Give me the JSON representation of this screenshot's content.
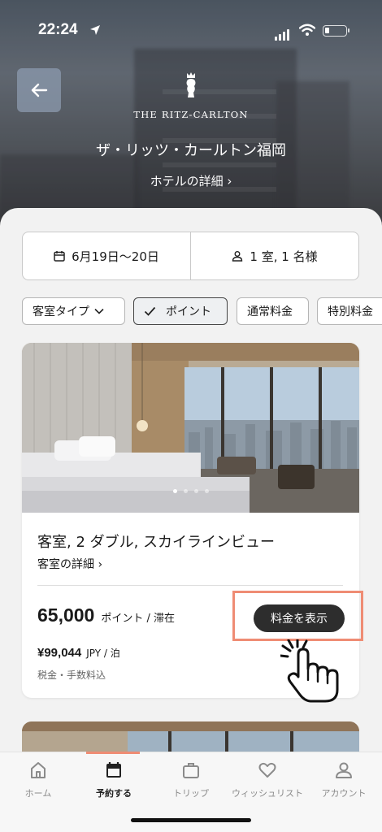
{
  "status_bar": {
    "time": "22:24"
  },
  "hero": {
    "brand": "THE RITZ-CARLTON",
    "hotel_name": "ザ・リッツ・カールトン福岡",
    "details_link": "ホテルの詳細 ›"
  },
  "search": {
    "dates": "6月19日〜20日",
    "guests": "1 室, 1 名様"
  },
  "filters": [
    {
      "label": "客室タイプ",
      "active": false
    },
    {
      "label": "ポイント",
      "active": true
    },
    {
      "label": "通常料金",
      "active": false
    },
    {
      "label": "特別料金",
      "active": false
    }
  ],
  "room": {
    "title": "客室, 2 ダブル, スカイラインビュー",
    "details_link": "客室の詳細 ›",
    "points_value": "65,000",
    "points_unit": "ポイント / 滞在",
    "cash_value": "¥99,044",
    "cash_unit": "JPY / 泊",
    "tax_note": "税金・手数料込",
    "rates_button": "料金を表示",
    "photo_index": 1,
    "photo_count": 4
  },
  "tabs": [
    {
      "label": "ホーム",
      "icon": "home-icon",
      "active": false
    },
    {
      "label": "予約する",
      "icon": "calendar-icon",
      "active": true
    },
    {
      "label": "トリップ",
      "icon": "suitcase-icon",
      "active": false
    },
    {
      "label": "ウィッシュリスト",
      "icon": "heart-icon",
      "active": false
    },
    {
      "label": "アカウント",
      "icon": "person-icon",
      "active": false
    }
  ],
  "colors": {
    "accent": "#ef8c74",
    "button_dark": "#2d2d2d"
  }
}
